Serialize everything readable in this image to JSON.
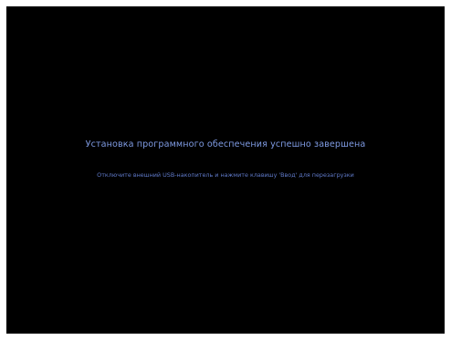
{
  "screen": {
    "background_color": "#000000",
    "title": "Установка программного обеспечения успешно завершена",
    "title_color": "#7f9be3",
    "instruction": "Отключите внешний USB-накопитель и нажмите клавишу 'Ввод' для перезагрузки",
    "instruction_color": "#5f79c8"
  }
}
